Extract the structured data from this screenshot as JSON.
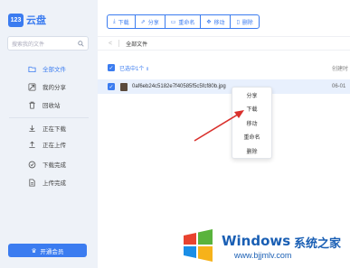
{
  "app": {
    "logo_badge": "123",
    "title": "云盘"
  },
  "search": {
    "placeholder": "搜索我的文件"
  },
  "sidebar": {
    "items": [
      {
        "label": "全部文件",
        "icon": "folder-icon",
        "active": true
      },
      {
        "label": "我的分享",
        "icon": "share-icon",
        "active": false
      },
      {
        "label": "回收站",
        "icon": "trash-icon",
        "active": false
      },
      {
        "label": "正在下载",
        "icon": "download-icon",
        "active": false
      },
      {
        "label": "正在上传",
        "icon": "upload-icon",
        "active": false
      },
      {
        "label": "下载完成",
        "icon": "check-circle-icon",
        "active": false
      },
      {
        "label": "上传完成",
        "icon": "document-icon",
        "active": false
      }
    ],
    "vip_button": "开通会员"
  },
  "toolbar": {
    "buttons": [
      {
        "label": "下载",
        "icon": "download-icon"
      },
      {
        "label": "分享",
        "icon": "share-icon"
      },
      {
        "label": "重命名",
        "icon": "rename-icon"
      },
      {
        "label": "移动",
        "icon": "move-icon"
      },
      {
        "label": "删除",
        "icon": "trash-icon"
      }
    ]
  },
  "breadcrumb": {
    "current": "全部文件"
  },
  "list": {
    "selected_text": "已选中1个",
    "date_header": "创建时",
    "files": [
      {
        "name": "0af6eb24c5182e7f40585f5c5fcf80b.jpg",
        "date": "06-01"
      }
    ]
  },
  "context_menu": {
    "items": [
      "分享",
      "下载",
      "移动",
      "重命名",
      "删除"
    ]
  },
  "watermark": {
    "title": "Windows",
    "subtitle": "系统之家",
    "url": "www.bjjmlv.com"
  },
  "colors": {
    "accent": "#3b7cf0",
    "sidebar_bg": "#eef2f8",
    "selected_row": "#e8f0fd",
    "arrow": "#d9302c"
  }
}
